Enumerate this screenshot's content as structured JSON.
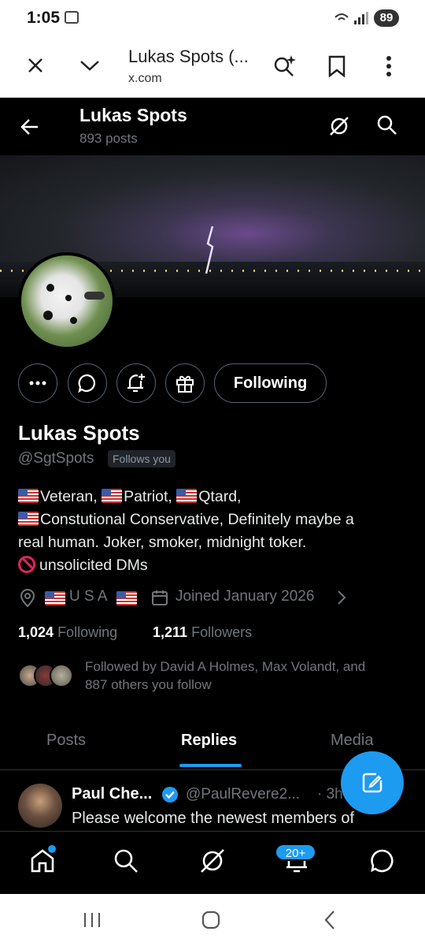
{
  "status_bar": {
    "time": "1:05",
    "battery": "89"
  },
  "browser": {
    "page_title": "Lukas Spots (...",
    "domain": "x.com"
  },
  "header": {
    "name": "Lukas Spots",
    "post_count": "893 posts"
  },
  "actions": {
    "following_label": "Following"
  },
  "profile": {
    "display_name": "Lukas Spots",
    "handle": "@SgtSpots",
    "follows_you": "Follows you",
    "bio_line1_a": "Veteran, ",
    "bio_line1_b": "Patriot, ",
    "bio_line1_c": "Qtard,",
    "bio_line2": "Constutional Conservative, Definitely maybe a",
    "bio_line3": "real human. Joker, smoker, midnight toker.",
    "bio_line4": "unsolicited DMs",
    "location": "U S A",
    "joined": "Joined January 2026",
    "following_count": "1,024",
    "following_label": "Following",
    "followers_count": "1,211",
    "followers_label": "Followers",
    "followed_by_line1": "Followed by David A Holmes, Max Volandt, and",
    "followed_by_line2": "887 others you follow"
  },
  "tabs": [
    {
      "label": "Posts",
      "active": false
    },
    {
      "label": "Replies",
      "active": true
    },
    {
      "label": "Media",
      "active": false
    }
  ],
  "post": {
    "author": "Paul Che...",
    "handle": "@PaulRevere2...",
    "time": "· 3h",
    "text": "Please welcome the newest members of"
  },
  "bottom_nav": {
    "notification_badge": "20+"
  },
  "colors": {
    "accent": "#1d9bf0",
    "background": "#000000",
    "text": "#e7e9ea",
    "muted": "#71767b"
  },
  "icons": [
    "close-icon",
    "chevron-down-icon",
    "search-sparkle-icon",
    "bookmark-icon",
    "more-vert-icon",
    "back-arrow-icon",
    "grok-icon",
    "search-icon",
    "ellipsis-icon",
    "message-icon",
    "notify-add-icon",
    "gift-icon",
    "location-icon",
    "calendar-icon",
    "chevron-right-icon",
    "compose-icon",
    "home-icon",
    "bell-icon",
    "chat-icon"
  ]
}
